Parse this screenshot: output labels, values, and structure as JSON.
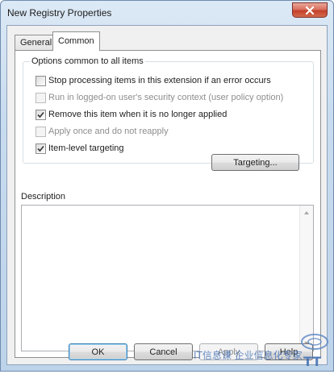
{
  "window": {
    "title": "New Registry Properties"
  },
  "tabs": [
    {
      "label": "General",
      "selected": false
    },
    {
      "label": "Common",
      "selected": true
    }
  ],
  "options_group": {
    "label": "Options common to all items",
    "options": [
      {
        "label": "Stop processing items in this extension if an error occurs",
        "checked": false,
        "enabled": true
      },
      {
        "label": "Run in logged-on user's security context (user policy option)",
        "checked": false,
        "enabled": false
      },
      {
        "label": "Remove this item when it is no longer applied",
        "checked": true,
        "enabled": true
      },
      {
        "label": "Apply once and do not reapply",
        "checked": false,
        "enabled": false
      },
      {
        "label": "Item-level targeting",
        "checked": true,
        "enabled": true
      }
    ],
    "targeting_button": "Targeting..."
  },
  "description": {
    "label": "Description",
    "value": ""
  },
  "buttons": {
    "ok": "OK",
    "cancel": "Cancel",
    "apply": "Apply",
    "help": "Help"
  },
  "watermark": {
    "text": "IT信息课   企业信息化专家",
    "logo_text": "TT"
  },
  "colors": {
    "accent": "#3c7fb1",
    "close_button": "#c3402b",
    "disabled_text": "#8d8d8d"
  }
}
